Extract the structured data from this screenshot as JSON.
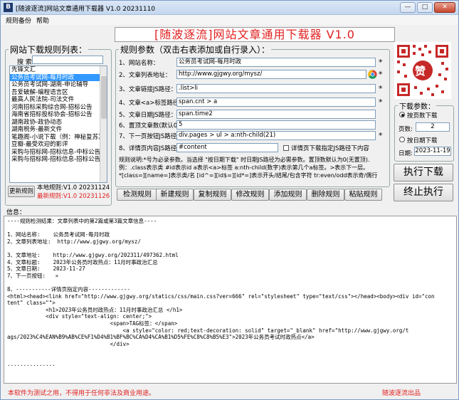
{
  "window": {
    "icon": "B",
    "title": "[随波逐流]网站文章通用下载器 V1.0 20231110",
    "buttons": [
      "—",
      "□",
      "✕"
    ]
  },
  "menu": [
    "规则备份",
    "帮助"
  ],
  "banner": "[随波逐流]网站文章通用下载器 V1.0",
  "rule_list": {
    "legend": "网站下载规则列表：",
    "search_label": "搜 索：",
    "search_value": "",
    "items": [
      "先锋文汇",
      "公务员考试网-每月时政",
      "公务员考试网-湖南-申论辅导",
      "吾爱破解-编程语言区",
      "最高人民法院-司法文件",
      "河南招标采购综合网-招标公告",
      "海南省招标投标协会-招标公告",
      "湖南政协-政协动态",
      "湖南税务-最新文件",
      "笔趣阁-小说下载（例：神秘复苏）",
      "豆瓣-最受欢迎的影评",
      "采购与招标网-招标信息-中标公告",
      "采购与招标网-招标信息-招标公告"
    ],
    "selected_index": 1
  },
  "rule_update": {
    "button": "更新规则",
    "local": "本地规则:V1.0 20231124",
    "latest": "最新规则:V1.0 20231126"
  },
  "params": {
    "legend": "规则参数（双击右表添加或自行录入）：",
    "fields": [
      {
        "label": "1、网站名称：",
        "value": "公务员考试网-每月时政",
        "star": true
      },
      {
        "label": "2、文章列表地址：",
        "value": "http://www.gjgwy.org/mysz/",
        "star": true
      },
      {
        "label": "3、文章链接JS路径：",
        "value": ".list>li",
        "star": true
      },
      {
        "label": "4、文章<a>标签路径：",
        "value": "span.cnt > a",
        "star": true
      },
      {
        "label": "5、文章日期JS路径：",
        "value": "span.time2",
        "star": false
      },
      {
        "label": "6、置顶文章数(默认0)：",
        "value": "5",
        "star": false
      },
      {
        "label": "7、下一页按钮JS路径：",
        "value": "div.pages > ul > a:nth-child(21)",
        "star": true
      },
      {
        "label": "8、详情页内容JS路径：",
        "value": "#content",
        "star": false
      }
    ],
    "detail_checkbox": "详情页下载指定JS路径下内容",
    "notes": [
      "规则说明:*号为必录参数。当选择 \"按日期下载\" 时日期JS路径为必需参数。置顶数默认为0(无置顶).",
      "例：.class表示类 #id表示id a表示<a>标签 a:nth-child(数字)表示第几个a标签。>表示下一层。",
      "*[class=][name=]表示类/名 [id^=][id$=][id*=]表示开头/结尾/包含字符 tr:even/odd表示奇/偶行"
    ]
  },
  "download_params": {
    "legend": "下载参数：",
    "by_count": "按页数下载",
    "pages_label": "页数:",
    "pages_value": "2",
    "by_date": "按日期下载",
    "date_label": "日期:",
    "date_value": "2023-11-19"
  },
  "qr": {
    "center_char": "赞"
  },
  "actions": {
    "run": "执行下载",
    "stop": "终止执行",
    "row": [
      "检测规则",
      "新建规则",
      "复制规则",
      "修改规则",
      "添加规则",
      "删除规则",
      "粘贴规则"
    ]
  },
  "info": {
    "label": "信息：",
    "lines": [
      "----规则检测结果：文章列表中的第2篇或第3篇文章信息----",
      "",
      "1、网站名称:    公务员考试网-每月时政",
      "2、文章列表地址:  http://www.gjgwy.org/mysz/",
      "",
      "3、文章地址:    http://www.gjgwy.org/202311/497362.html",
      "4、文章标题:    2023年公务员时政热点：11月时事政治汇总",
      "5、文章日期:    2023-11-27",
      "7、下一页按钮:   »",
      "",
      "8、-----------详情页指定内容-------------",
      "<html><head><link href=\"http://www.gjgwy.org/statics/css/main.css?ver=666\" rel=\"stylesheet\" type=\"text/css\"></head><body><div id=\"con",
      "tent\" class=\"\">",
      "            <h1>2023年公务员时政热点：11月时事政治汇总 </h1>",
      "            <div style=\"text-align: center;\">",
      "                                <span>TAG标签：</span>",
      "                                    <a style=\"color: red;text-decoration: solid\" target=\"_blank\" href=\"http://www.gjgwy.org/t",
      "ags/2023%C4%EAN%B9%AB%CE%F1%D4%B1%BF%BC%CA%D4%CA%B1%D5%FE%C8%C8%B5%E3\">2023年公务员考试时政热点</a>",
      "                                </div>",
      "",
      "",
      "..............."
    ]
  },
  "footer": {
    "left": "本软件为测试之用，不得用于任何非法及商业用途。",
    "right": "随波逐流出品"
  },
  "colors": {
    "accent_red": "#e02020",
    "selection": "#3399ff"
  },
  "icons": {
    "url_field": "chrome-icon"
  }
}
